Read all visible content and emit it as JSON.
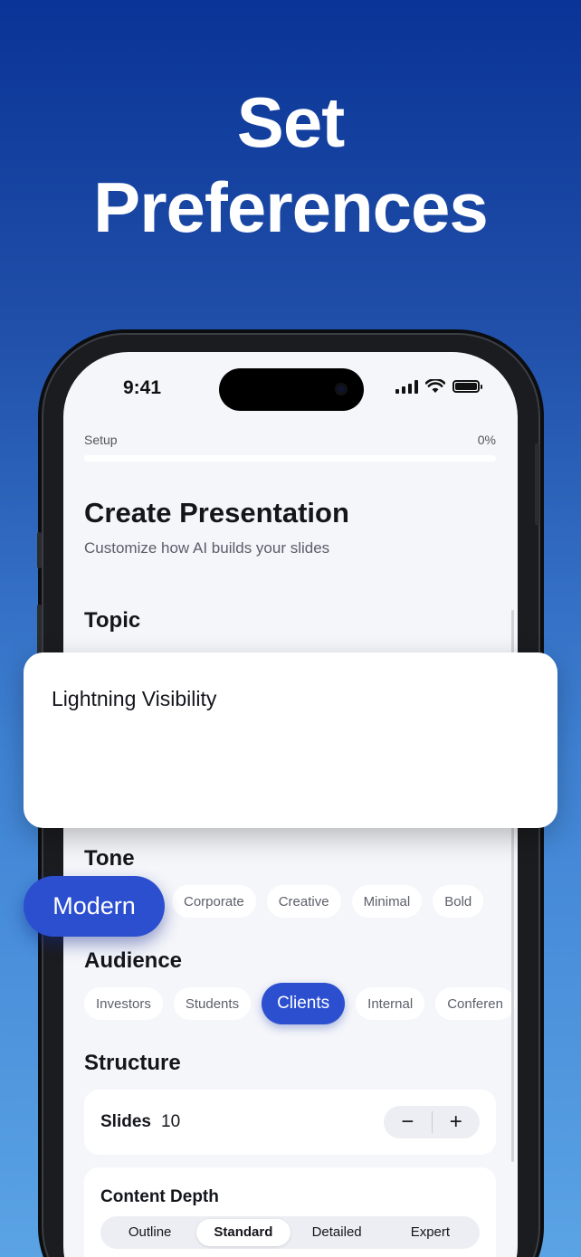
{
  "headline": {
    "line1": "Set",
    "line2": "Preferences"
  },
  "status_bar": {
    "time": "9:41"
  },
  "setup": {
    "label": "Setup",
    "percent": "0%",
    "progress_fraction": 0.0
  },
  "header": {
    "title": "Create Presentation",
    "subtitle": "Customize how AI builds your slides"
  },
  "topic": {
    "label": "Topic",
    "value": "Lightning Visibility"
  },
  "tone": {
    "label": "Tone",
    "selected": "Modern",
    "options": [
      "Corporate",
      "Creative",
      "Minimal",
      "Bold"
    ]
  },
  "audience": {
    "label": "Audience",
    "options": [
      "Investors",
      "Students",
      "Clients",
      "Internal",
      "Conferen"
    ],
    "selected": "Clients"
  },
  "structure": {
    "label": "Structure",
    "slides_label": "Slides",
    "slides_value": "10",
    "minus": "−",
    "plus": "+"
  },
  "content_depth": {
    "label": "Content Depth",
    "options": [
      "Outline",
      "Standard",
      "Detailed",
      "Expert"
    ],
    "selected": "Standard"
  },
  "colors": {
    "accent": "#2c4fd0",
    "background_top": "#0a3497",
    "background_bottom": "#5aa3e4"
  }
}
